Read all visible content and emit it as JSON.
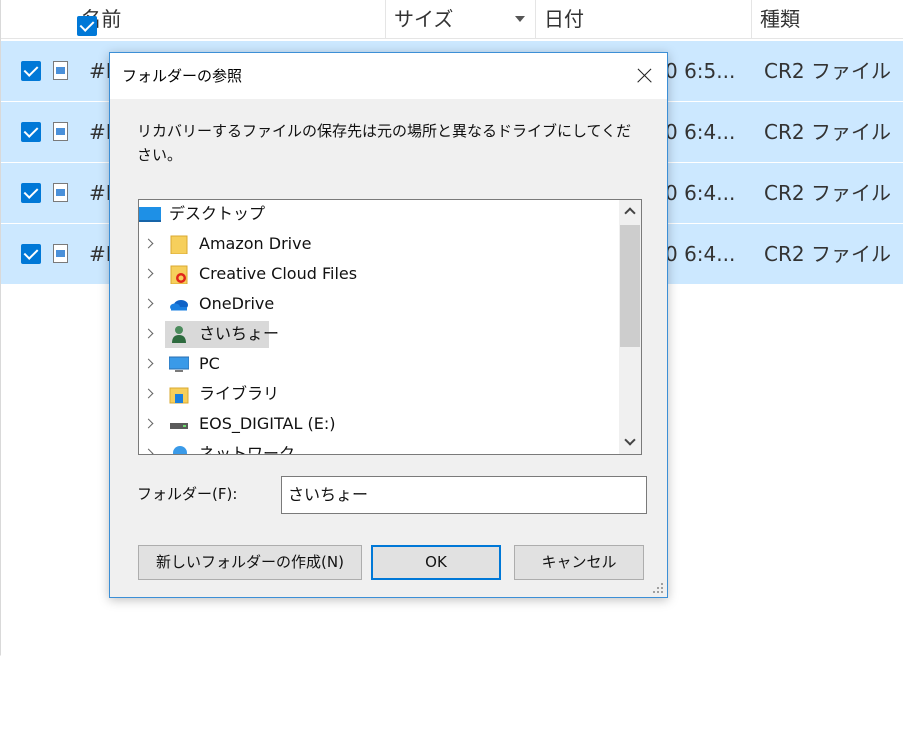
{
  "list": {
    "columns": {
      "name": "名前",
      "size": "サイズ",
      "date": "日付",
      "type": "種類"
    },
    "rows": [
      {
        "name": "#I",
        "date": "0 6:5...",
        "type": "CR2 ファイル"
      },
      {
        "name": "#I",
        "date": "0 6:4...",
        "type": "CR2 ファイル"
      },
      {
        "name": "#I",
        "date": "0 6:4...",
        "type": "CR2 ファイル"
      },
      {
        "name": "#I",
        "date": "0 6:4...",
        "type": "CR2 ファイル"
      }
    ]
  },
  "dialog": {
    "title": "フォルダーの参照",
    "description": "リカバリーするファイルの保存先は元の場所と異なるドライブにしてください。",
    "tree": [
      {
        "label": "デスクトップ",
        "icon": "desktop-icon"
      },
      {
        "label": "Amazon Drive",
        "icon": "folder-icon"
      },
      {
        "label": "Creative Cloud Files",
        "icon": "creative-cloud-folder-icon"
      },
      {
        "label": "OneDrive",
        "icon": "onedrive-cloud-icon"
      },
      {
        "label": "さいちょー",
        "icon": "user-icon",
        "selected": true
      },
      {
        "label": "PC",
        "icon": "pc-monitor-icon"
      },
      {
        "label": "ライブラリ",
        "icon": "library-folder-icon"
      },
      {
        "label": "EOS_DIGITAL (E:)",
        "icon": "drive-icon"
      },
      {
        "label": "ネットワーク",
        "icon": "network-icon"
      }
    ],
    "folder_label": "フォルダー(F):",
    "folder_value": "さいちょー",
    "buttons": {
      "new_folder": "新しいフォルダーの作成(N)",
      "ok": "OK",
      "cancel": "キャンセル"
    }
  },
  "colors": {
    "accent": "#0078d7",
    "row_selected": "#cce8ff",
    "dialog_bg": "#f0f0f0"
  }
}
